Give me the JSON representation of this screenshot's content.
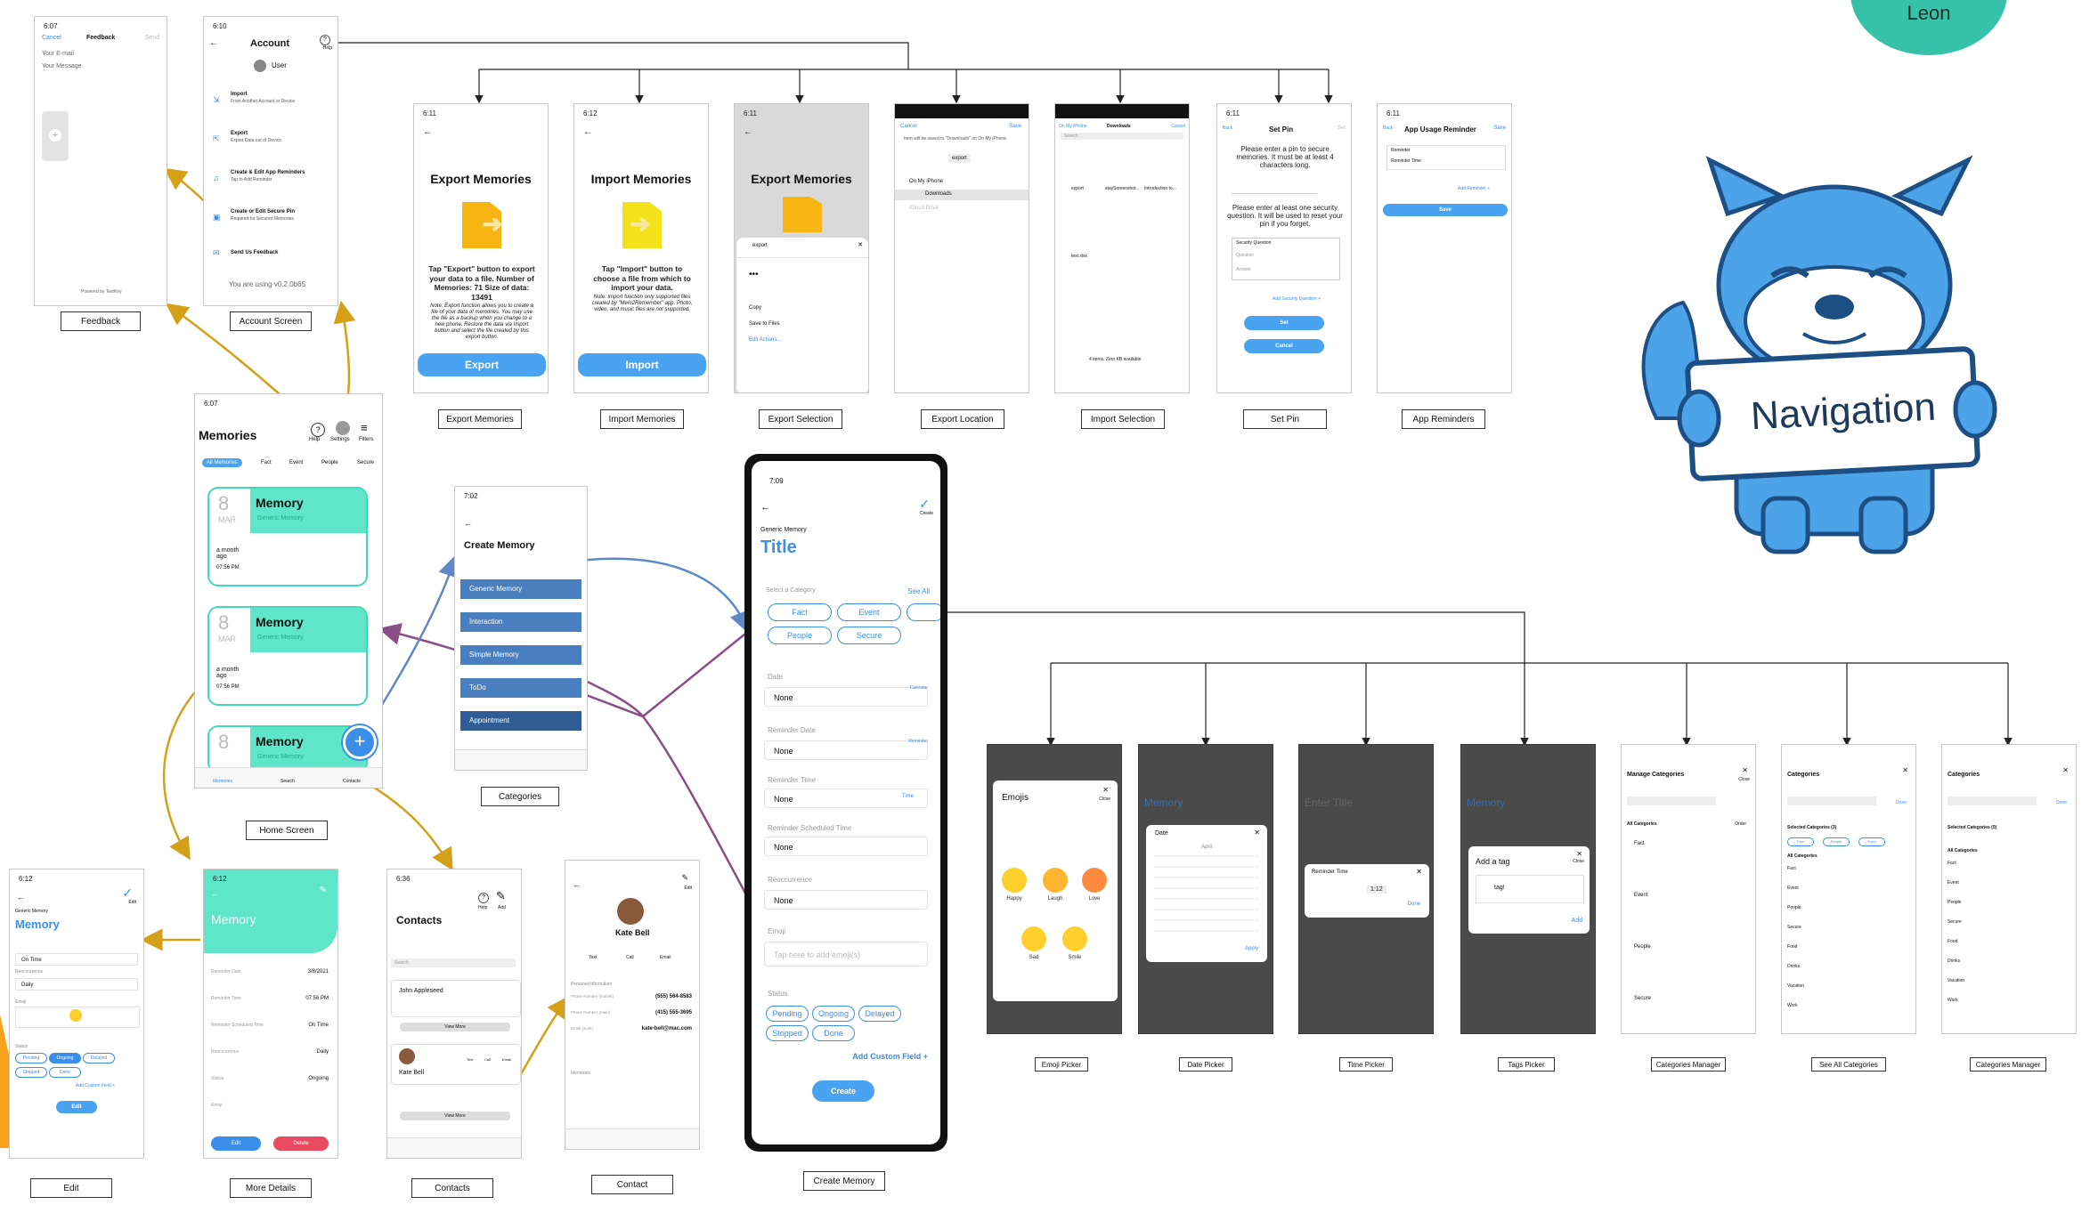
{
  "colors": {
    "teal": "#5fe6c8",
    "blue": "#4aa3f0",
    "arrow_gold": "#d4a017",
    "arrow_purple": "#8b4d86",
    "arrow_blue": "#5f88c8",
    "leon_circle": "#36c2a8"
  },
  "badge": {
    "name": "Leon"
  },
  "mascot": {
    "sign": "Navigation",
    "icon": "fox-mascot-icon"
  },
  "feedback": {
    "time": "6:07",
    "cancel": "Cancel",
    "title": "Feedback",
    "send": "Send",
    "placeholder_email": "Your E-mail",
    "placeholder_message": "Your Message",
    "footer": "Powered by TestKey",
    "caption": "Feedback"
  },
  "account": {
    "time": "6:10",
    "title": "Account",
    "help": "Help",
    "user": "User",
    "items": [
      {
        "title": "Import",
        "sub": "From Another Account or Device"
      },
      {
        "title": "Export",
        "sub": "Export Data out of Device"
      },
      {
        "title": "Create & Edit App Reminders",
        "sub": "Tap to Add Reminder"
      },
      {
        "title": "Create or Edit Secure Pin",
        "sub": "Required for Secured Memories"
      },
      {
        "title": "Send Us Feedback",
        "sub": ""
      }
    ],
    "version": "You are using v0.2.0b65",
    "caption": "Account Screen"
  },
  "export_memories": {
    "time": "6:11",
    "title": "Export Memories",
    "desc": "Tap \"Export\" button to export your data to a file. Number of Memories: 71 Size of data: 13491",
    "note": "Note: Export function allows you to create a file of your data of memories. You may use the file as a backup when you change to a new phone. Restore the data via Import button and select the file created by this export button.",
    "button": "Export",
    "caption": "Export Memories"
  },
  "import_memories": {
    "time": "6:12",
    "title": "Import Memories",
    "desc": "Tap \"Import\" button to choose a file from which to import your data.",
    "note": "Note: import function only supported files created by \"Mem2Remember\" app. Photo, video, and music files are not supported.",
    "button": "Import",
    "caption": "Import Memories"
  },
  "export_selection": {
    "time": "6:11",
    "title": "Export Memories",
    "file": "export",
    "items": [
      "Copy",
      "Save to Files",
      "Edit Actions..."
    ],
    "caption": "Export Selection"
  },
  "export_location": {
    "cancel": "Cancel",
    "save": "Save",
    "note": "Item will be saved to \"Downloads\" on On My iPhone.",
    "file": "export",
    "rows": [
      "On My iPhone",
      "Downloads",
      "iCloud Drive"
    ],
    "caption": "Export Location"
  },
  "import_selection": {
    "back": "On My iPhone",
    "title": "Downloads",
    "cancel": "Cancel",
    "search": "Search",
    "files": [
      "export",
      "stayScreenshot...",
      "Introduction to...",
      "text.xlsx"
    ],
    "footer": "4 items, Zero KB available",
    "caption": "Import Selection"
  },
  "set_pin": {
    "time": "6:11",
    "title": "Set Pin",
    "back": "Back",
    "set": "Set",
    "desc": "Please enter a pin to secure memories. It must be at least 4 characters long.",
    "desc2": "Please enter at least one security question. It will be used to reset your pin if you forget.",
    "fields": [
      "Security Question",
      "Question",
      "Answer"
    ],
    "add": "Add Security Question +",
    "btn_set": "Set",
    "btn_cancel": "Cancel",
    "caption": "Set Pin"
  },
  "app_reminders": {
    "time": "6:11",
    "title": "App Usage Reminder",
    "back": "Back",
    "save": "Save",
    "rows": [
      "Reminder",
      "Reminder Time"
    ],
    "add": "Add Reminder +",
    "btn": "Save",
    "caption": "App Reminders"
  },
  "home": {
    "time": "6:07",
    "title": "Memories",
    "help": "Help",
    "settings": "Settings",
    "filters": "Filters",
    "chips": [
      "All Memories",
      "Fact",
      "Event",
      "People",
      "Secure"
    ],
    "cards": [
      {
        "day": "8",
        "month": "MAR",
        "title": "Memory",
        "sub": "Generic Memory",
        "ago": "a month ago",
        "time": "07:56 PM"
      },
      {
        "day": "8",
        "month": "MAR",
        "title": "Memory",
        "sub": "Generic Memory",
        "ago": "a month ago",
        "time": "07:56 PM"
      },
      {
        "day": "8",
        "month": "MAR",
        "title": "Memory",
        "sub": "Generic Memory",
        "ago": "",
        "time": ""
      }
    ],
    "tabs": [
      "Memories",
      "Search",
      "Contacts"
    ],
    "caption": "Home Screen"
  },
  "categories": {
    "time": "7:02",
    "title": "Create Memory",
    "items": [
      "Generic Memory",
      "Interaction",
      "Simple Memory",
      "ToDo",
      "Appointment"
    ],
    "caption": "Categories"
  },
  "create_memory": {
    "time": "7:09",
    "kind": "Generic Memory",
    "title": "Title",
    "create_top": "Create",
    "select": "Select a Category",
    "see_all": "See All",
    "cats": [
      "Fact",
      "Event",
      "People",
      "Secure"
    ],
    "labels": [
      "Date",
      "Reminder Date",
      "Reminder Time",
      "Reminder Scheduled Time",
      "Reoccurrence",
      "Emoji"
    ],
    "values": [
      "None",
      "None",
      "None",
      "None",
      "None",
      "Tap here to add emoji(s)"
    ],
    "right": [
      "Calendar",
      "Reminder",
      "Time",
      ""
    ],
    "status_label": "Status",
    "statuses": [
      "Pending",
      "Ongoing",
      "Delayed",
      "Stopped",
      "Done"
    ],
    "add_field": "Add Custom Field +",
    "create": "Create",
    "caption": "Create Memory"
  },
  "edit": {
    "time": "6:12",
    "kind": "Generic Memory",
    "title": "Memory",
    "edit": "Edit",
    "rows": [
      "On Time",
      "Daily"
    ],
    "labels": [
      "Reoccurrence",
      "Emoji"
    ],
    "status": "Status",
    "statuses": [
      "Pending",
      "Ongoing",
      "Delayed",
      "Stopped",
      "Done"
    ],
    "add": "Add Custom Field +",
    "button": "Edit",
    "caption": "Edit"
  },
  "more_details": {
    "time": "6:12",
    "title": "Memory",
    "rows": [
      [
        "Reminder Date",
        "3/8/2021"
      ],
      [
        "Reminder Time",
        "07:56 PM"
      ],
      [
        "Reminder Scheduled Time",
        "On Time"
      ],
      [
        "Reoccurrence",
        "Daily"
      ],
      [
        "Status",
        "Ongoing"
      ],
      [
        "Emoji",
        ""
      ]
    ],
    "edit": "Edit",
    "delete": "Delete",
    "caption": "More Details"
  },
  "contacts": {
    "time": "6:36",
    "title": "Contacts",
    "help": "Help",
    "add": "Add",
    "search": "Search",
    "c1": "John Appleseed",
    "c2": "Kate Bell",
    "more": "View More",
    "actions": [
      "Text",
      "Call",
      "Email"
    ],
    "caption": "Contacts"
  },
  "contact": {
    "time": "",
    "name": "Kate Bell",
    "edit": "Edit",
    "actions": [
      "Text",
      "Call",
      "Email"
    ],
    "section": "Personal Information",
    "rows": [
      [
        "Phone Number (mobile)",
        "(555) 564-8583"
      ],
      [
        "Phone Number (main)",
        "(415) 555-3695"
      ],
      [
        "Email (work)",
        "kate-bell@mac.com"
      ]
    ],
    "section2": "Memories",
    "caption": "Contact"
  },
  "emoji_picker": {
    "title": "Emojis",
    "close": "Close",
    "emojis": [
      "Happy",
      "Laugh",
      "Love",
      "Sad",
      "Smile"
    ],
    "caption": "Emoji Picker"
  },
  "date_picker": {
    "title": "Date",
    "month": "April",
    "apply": "Apply",
    "bg_title": "Memory",
    "caption": "Date Picker"
  },
  "time_picker": {
    "title": "Reminder Time",
    "time": "1:12",
    "done": "Done",
    "bg_title": "Enter Title",
    "caption": "Time Picker"
  },
  "tags_picker": {
    "title": "Add a tag",
    "close": "Close",
    "tag": "tag!",
    "add": "Add",
    "bg_title": "Memory",
    "caption": "Tags Picker"
  },
  "cat_manager": {
    "title": "Manage Categories",
    "close": "Close",
    "header": "All Categories",
    "order": "Order",
    "items": [
      "Fact",
      "Event",
      "People",
      "Secure"
    ],
    "caption": "Categories Manager"
  },
  "see_all": {
    "title": "Categories",
    "done": "Done",
    "selected": "Selected Categories (3)",
    "chips": [
      "Fact",
      "People",
      "Food"
    ],
    "header": "All Categories",
    "items": [
      "Fact",
      "Event",
      "People",
      "Secure",
      "Food",
      "Drinks",
      "Vacation",
      "Work"
    ],
    "caption": "See All Categories"
  },
  "cat_manager2": {
    "title": "Categories",
    "done": "Done",
    "selected": "Selected Categories (0)",
    "header": "All Categories",
    "items": [
      "Fact",
      "Event",
      "People",
      "Secure",
      "Food",
      "Drinks",
      "Vacation",
      "Work"
    ],
    "caption": "Categories Manager"
  }
}
